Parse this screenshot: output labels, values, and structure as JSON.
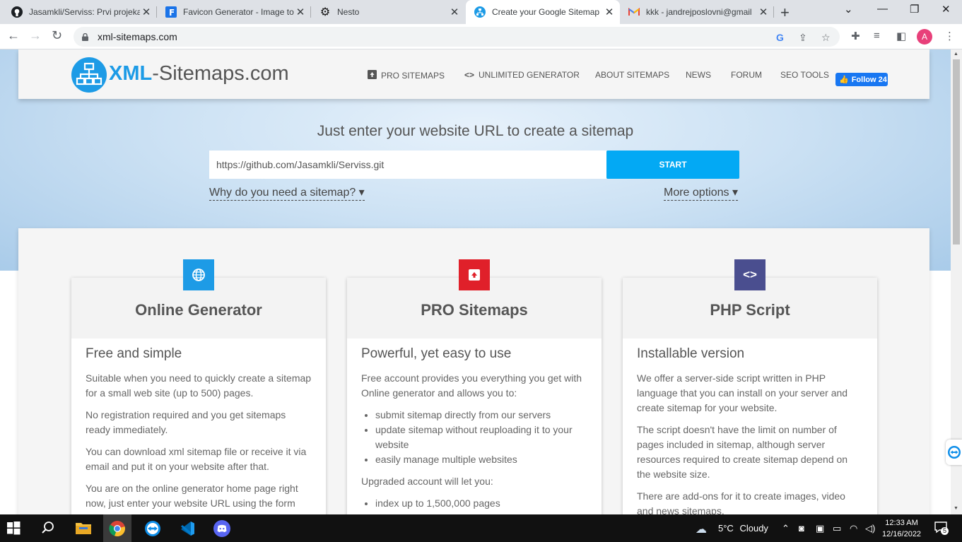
{
  "tabs": [
    {
      "title": "Jasamkli/Serviss: Prvi projeka",
      "icon": "github-icon"
    },
    {
      "title": "Favicon Generator - Image to",
      "icon": "favicon-generator-icon"
    },
    {
      "title": "Nesto",
      "icon": "gear-icon"
    },
    {
      "title": "Create your Google Sitemap",
      "icon": "xml-sitemaps-icon"
    },
    {
      "title": "kkk - jandrejposlovni@gmail",
      "icon": "gmail-icon"
    }
  ],
  "active_tab_index": 3,
  "address_bar": {
    "url": "xml-sitemaps.com"
  },
  "profile": {
    "initial": "A",
    "color": "#e8407a"
  },
  "site": {
    "logo_bold": "XML",
    "logo_rest": "-Sitemaps.com",
    "nav": [
      {
        "label": "PRO SITEMAPS",
        "icon": "pro-sitemaps-icon"
      },
      {
        "label": "UNLIMITED GENERATOR",
        "icon": "code-icon"
      },
      {
        "label": "ABOUT SITEMAPS"
      },
      {
        "label": "NEWS"
      },
      {
        "label": "FORUM"
      },
      {
        "label": "SEO TOOLS"
      }
    ],
    "fb_follow": "Follow 24",
    "tagline": "Just enter your website URL to create a sitemap",
    "url_value": "https://github.com/Jasamkli/Serviss.git",
    "start_label": "START",
    "why_link": "Why do you need a sitemap? ▾",
    "more_options": "More options ▾"
  },
  "cards": [
    {
      "title": "Online Generator",
      "icon": "globe-icon",
      "icon_color": "#1d9be6",
      "subtitle": "Free and simple",
      "paragraphs": [
        "Suitable when you need to quickly create a sitemap for a small web site (up to 500) pages.",
        "No registration required and you get sitemaps ready immediately.",
        "You can download xml sitemap file or receive it via email and put it on your website after that.",
        "You are on the online generator home page right now, just enter your website URL using the form"
      ]
    },
    {
      "title": "PRO Sitemaps",
      "icon": "upload-icon",
      "icon_color": "#e0202a",
      "subtitle": "Powerful, yet easy to use",
      "intro": "Free account provides you everything you get with Online generator and allows you to:",
      "list1": [
        "submit sitemap directly from our servers",
        "update sitemap without reuploading it to your website",
        "easily manage multiple websites"
      ],
      "middle": "Upgraded account will let you:",
      "list2": [
        "index up to 1,500,000 pages"
      ]
    },
    {
      "title": "PHP Script",
      "icon": "code-icon",
      "icon_color": "#4a4e8f",
      "subtitle": "Installable version",
      "paragraphs": [
        "We offer a server-side script written in PHP language that you can install on your server and create sitemap for your website.",
        "The script doesn't have the limit on number of pages included in sitemap, although server resources required to create sitemap depend on the website size.",
        "There are add-ons for it to create images, video and news sitemaps."
      ]
    }
  ],
  "taskbar": {
    "weather_temp": "5°C",
    "weather_text": "Cloudy",
    "time": "12:33 AM",
    "date": "12/16/2022",
    "notifications": "5"
  }
}
